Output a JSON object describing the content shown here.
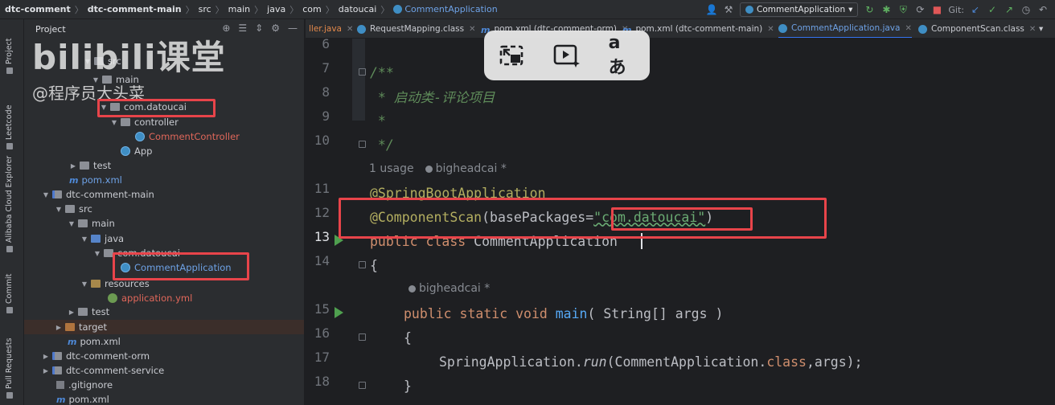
{
  "breadcrumb": [
    "dtc-comment",
    "dtc-comment-main",
    "src",
    "main",
    "java",
    "com",
    "datoucai",
    "CommentApplication"
  ],
  "toolbar": {
    "run_config": "CommentApplication",
    "git_label": "Git:"
  },
  "tool_strip": [
    "Project",
    "Leetcode",
    "Alibaba Cloud Explorer",
    "Commit",
    "Pull Requests"
  ],
  "project_panel": {
    "title": "Project",
    "watermark": "bilibili课堂",
    "watermark_sub": "@程序员大头菜",
    "tree": {
      "src_1": "src",
      "main_1": "main",
      "pkg_1": "com.datoucai",
      "controller": "controller",
      "comment_controller": "CommentController",
      "app": "App",
      "test_1": "test",
      "pom_1": "pom.xml",
      "module_main": "dtc-comment-main",
      "src_2": "src",
      "main_2": "main",
      "java": "java",
      "pkg_2": "com.datoucai",
      "comment_application": "CommentApplication",
      "resources": "resources",
      "application_yml": "application.yml",
      "test_2": "test",
      "target": "target",
      "pom_2": "pom.xml",
      "module_orm": "dtc-comment-orm",
      "module_service": "dtc-comment-service",
      "gitignore": ".gitignore",
      "pom_3": "pom.xml"
    }
  },
  "editor": {
    "tabs": [
      "ller.java",
      "RequestMapping.class",
      "pom.xml (dtc-comment-orm)",
      "pom.xml (dtc-comment-main)",
      "CommentApplication.java",
      "ComponentScan.class"
    ],
    "line_numbers": [
      "6",
      "7",
      "8",
      "9",
      "10",
      "11",
      "12",
      "13",
      "14",
      "15",
      "16",
      "17",
      "18"
    ],
    "usage_hint": "1 usage",
    "author_hint": "bigheadcai *",
    "author_hint_2": "bigheadcai *",
    "code": {
      "l7": "/**",
      "l8": " * 启动类-评论项目",
      "l9": " *",
      "l10": " */",
      "l11": "@SpringBootApplication",
      "l12_ann": "@ComponentScan",
      "l12_open": "(basePackages=",
      "l12_str": "\"com.datoucai\"",
      "l12_close": ")",
      "l13_kw": "public class ",
      "l13_name": "CommentApplication",
      "l14": "{",
      "l15_kw": "public static void ",
      "l15_method": "main",
      "l15_rest": "( String[] args )",
      "l16": "{",
      "l17_pre": "SpringApplication.",
      "l17_run": "run",
      "l17_mid": "(CommentApplication.",
      "l17_kw": "class",
      "l17_end": ",args);",
      "l18": "}"
    }
  },
  "overlay": {
    "icons": [
      "exit-pip-icon",
      "ai-play-icon",
      "translate-icon"
    ],
    "translate_label": "aあ"
  }
}
